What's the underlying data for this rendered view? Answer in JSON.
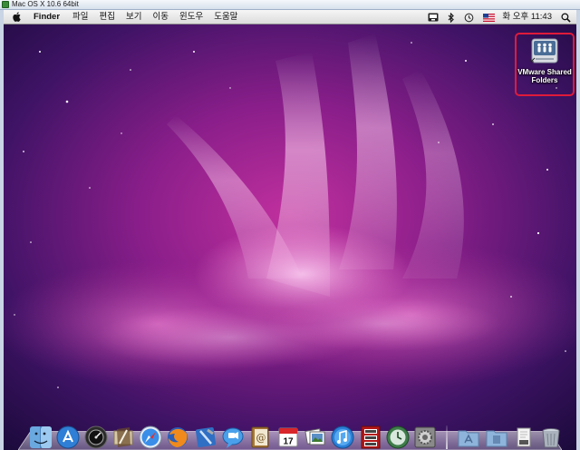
{
  "window": {
    "title": "Mac OS X 10.6 64bit"
  },
  "menubar": {
    "app_name": "Finder",
    "items": [
      "파일",
      "편집",
      "보기",
      "이동",
      "윈도우",
      "도움말"
    ],
    "clock": "화 오후 11:43"
  },
  "desktop": {
    "icon_label": "VMware Shared Folders",
    "highlight_color": "#e01a3a"
  },
  "dock": {
    "apps": [
      "finder-icon",
      "app-store-icon",
      "dashboard-icon",
      "mail-icon",
      "safari-icon",
      "firefox-icon",
      "xcode-icon",
      "ichat-icon",
      "address-book-icon",
      "ical-icon",
      "iphoto-icon",
      "itunes-icon",
      "photo-booth-icon",
      "time-machine-icon",
      "system-preferences-icon"
    ],
    "calendar_day": "17",
    "stacks": [
      "applications-folder-icon",
      "documents-folder-icon",
      "downloads-stack-icon",
      "trash-icon"
    ]
  },
  "colors": {
    "accent": "#e01a3a",
    "menubar": "#e8e8e8"
  }
}
